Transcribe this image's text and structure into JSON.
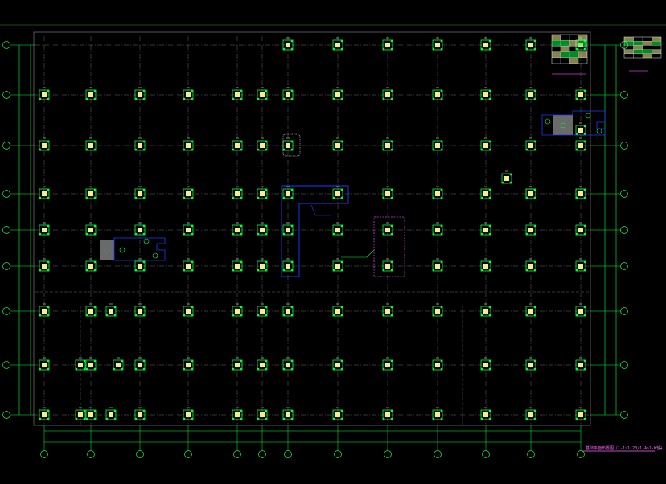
{
  "drawing": {
    "caption": "基础平面布置图（1-1~1-20/1-A~1-K轴）",
    "colors": {
      "background": "#000000",
      "grid_line": "#9a9a9a",
      "axis_green": "#00ff3c",
      "column_fill": "#f2ef8c",
      "pile_green": "#00ff3c",
      "callout_blue": "#1e3cff",
      "highlight_magenta": "#d23cd2",
      "text_white": "#d8d8d8",
      "caption_magenta": "#ff66ff"
    },
    "legend_table": {
      "rows": 5,
      "cols": 4
    },
    "icons": [
      "axis-bubble-icon",
      "pile-cap-icon",
      "column-icon",
      "detail-callout-icon"
    ]
  }
}
